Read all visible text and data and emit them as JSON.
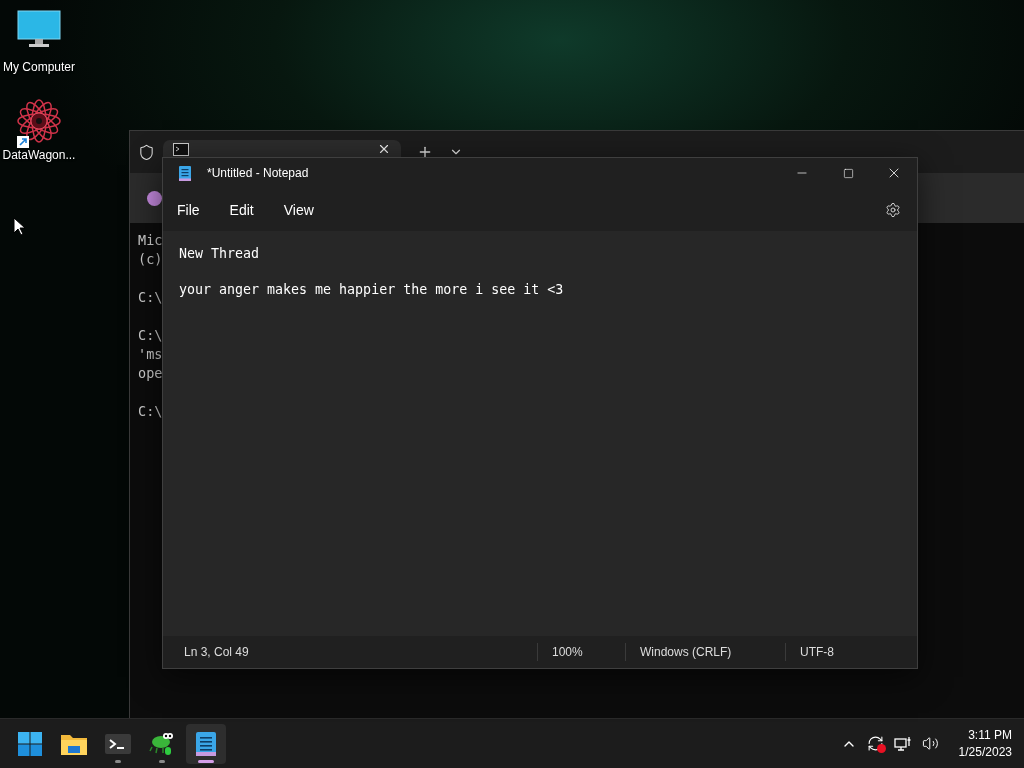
{
  "desktop_icons": [
    {
      "kind": "computer",
      "label": "My Computer",
      "shortcut": false
    },
    {
      "kind": "star",
      "label": "DataWagon...",
      "shortcut": true
    }
  ],
  "terminal": {
    "console_blocks": [
      [
        "Mic",
        "(c)"
      ],
      [
        "C:\\"
      ],
      [
        "C:\\",
        "'ms",
        "ope"
      ],
      [
        "C:\\"
      ]
    ]
  },
  "notepad": {
    "title": "*Untitled - Notepad",
    "menu": [
      "File",
      "Edit",
      "View"
    ],
    "lines": [
      "New Thread",
      "your anger makes me happier the more i see it <3"
    ],
    "status_bar": {
      "position": "Ln 3, Col 49",
      "zoom": "100%",
      "line_ending": "Windows (CRLF)",
      "encoding": "UTF-8"
    }
  },
  "taskbar": {
    "apps": [
      {
        "kind": "start",
        "running": false,
        "active": false
      },
      {
        "kind": "explorer",
        "running": false,
        "active": false
      },
      {
        "kind": "terminal",
        "running": true,
        "active": false
      },
      {
        "kind": "bug",
        "running": true,
        "active": false
      },
      {
        "kind": "notepad",
        "running": true,
        "active": true
      }
    ],
    "time": "3:11 PM",
    "date": "1/25/2023"
  }
}
